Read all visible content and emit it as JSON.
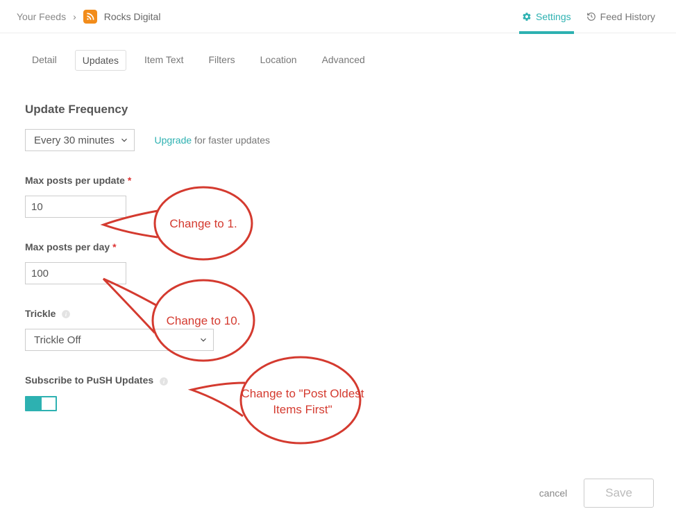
{
  "breadcrumb": {
    "root": "Your Feeds",
    "separator": "›",
    "current": "Rocks Digital"
  },
  "header_actions": {
    "settings": "Settings",
    "history": "Feed History"
  },
  "tabs": [
    "Detail",
    "Updates",
    "Item Text",
    "Filters",
    "Location",
    "Advanced"
  ],
  "active_tab": "Updates",
  "sections": {
    "update_frequency": {
      "title": "Update Frequency",
      "selected": "Every 30 minutes",
      "upgrade_link": "Upgrade",
      "upgrade_text": " for faster updates"
    },
    "max_per_update": {
      "label": "Max posts per update",
      "value": "10"
    },
    "max_per_day": {
      "label": "Max posts per day",
      "value": "100"
    },
    "trickle": {
      "label": "Trickle",
      "selected": "Trickle Off"
    },
    "push": {
      "label": "Subscribe to PuSH Updates",
      "enabled": true
    }
  },
  "footer": {
    "cancel": "cancel",
    "save": "Save"
  },
  "annotations": {
    "a1": "Change to 1.",
    "a2": "Change to 10.",
    "a3": "Change to \"Post Oldest Items First\""
  }
}
